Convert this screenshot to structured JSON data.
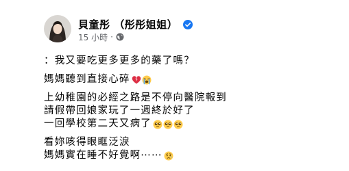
{
  "post": {
    "author_name": "貝童彤 （彤彤姐姐）",
    "time_label": "15 小時",
    "dot": "·",
    "lines": {
      "l1": "：我又要吃更多更多的藥了嗎？",
      "l2": "媽媽聽到直接心碎",
      "l3": "上幼稚園的必經之路是不停向醫院報到",
      "l4": "請假帶回娘家玩了一週終於好了",
      "l5": "一回學校第二天又病了",
      "l6": "看妳咳得眼眶泛淚",
      "l7": "媽媽實在睡不好覺啊⋯⋯"
    }
  },
  "colors": {
    "verified_blue": "#1877f2",
    "meta_gray": "#65676b",
    "text": "#050505"
  },
  "icons": {
    "verified": "verified-badge-icon",
    "privacy": "globe-icon",
    "broken_heart": "broken-heart-emoji",
    "crying": "loudly-crying-emoji",
    "pleading": "pleading-face-emoji",
    "sad": "sad-relieved-face-emoji"
  }
}
